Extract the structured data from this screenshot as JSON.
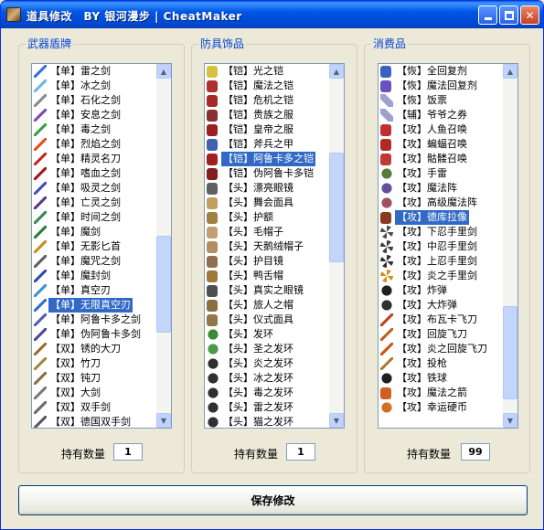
{
  "window": {
    "title": "道具修改　BY 银河漫步 | CheatMaker"
  },
  "groups": [
    {
      "label": "武器盾牌",
      "qty_label": "持有数量",
      "qty_value": "1",
      "scroll_thumb": {
        "start": 0.47,
        "size": 0.29
      },
      "items": [
        {
          "text": "【单】雷之剑",
          "icon": "sword-icon",
          "color": "#3a6fd8"
        },
        {
          "text": "【单】冰之剑",
          "icon": "sword-icon",
          "color": "#6cb8e8"
        },
        {
          "text": "【单】石化之剑",
          "icon": "sword-icon",
          "color": "#8a8a8a"
        },
        {
          "text": "【单】安息之剑",
          "icon": "sword-icon",
          "color": "#7a4ab0"
        },
        {
          "text": "【单】毒之剑",
          "icon": "sword-icon",
          "color": "#3aa040"
        },
        {
          "text": "【单】烈焰之剑",
          "icon": "sword-icon",
          "color": "#e05020"
        },
        {
          "text": "【单】精灵名刀",
          "icon": "sword-icon",
          "color": "#c02828"
        },
        {
          "text": "【单】嗜血之剑",
          "icon": "sword-icon",
          "color": "#a01818"
        },
        {
          "text": "【单】吸灵之剑",
          "icon": "sword-icon",
          "color": "#4050c0"
        },
        {
          "text": "【单】亡灵之剑",
          "icon": "sword-icon",
          "color": "#5a3a8a"
        },
        {
          "text": "【单】时间之剑",
          "icon": "sword-icon",
          "color": "#3a8a50"
        },
        {
          "text": "【单】魔剑",
          "icon": "sword-icon",
          "color": "#2a7a3a"
        },
        {
          "text": "【单】无影匕首",
          "icon": "dagger-icon",
          "color": "#c09020"
        },
        {
          "text": "【单】魔咒之剑",
          "icon": "sword-icon",
          "color": "#606060"
        },
        {
          "text": "【单】魔封剑",
          "icon": "sword-icon",
          "color": "#2a50a0"
        },
        {
          "text": "【单】真空刃",
          "icon": "sword-icon",
          "color": "#4090d0"
        },
        {
          "text": "【单】无限真空刃",
          "icon": "sword-icon",
          "color": "#3070c0",
          "selected": true
        },
        {
          "text": "【单】阿鲁卡多之剑",
          "icon": "sword-icon",
          "color": "#5060b0"
        },
        {
          "text": "【单】伪阿鲁卡多剑",
          "icon": "sword-icon",
          "color": "#4a4a9a"
        },
        {
          "text": "【双】锈的大刀",
          "icon": "blade-icon",
          "color": "#9a6a30"
        },
        {
          "text": "【双】竹刀",
          "icon": "blade-icon",
          "color": "#a08840"
        },
        {
          "text": "【双】钝刀",
          "icon": "blade-icon",
          "color": "#8a7040"
        },
        {
          "text": "【双】大剑",
          "icon": "blade-icon",
          "color": "#7a7a7a"
        },
        {
          "text": "【双】双手剑",
          "icon": "blade-icon",
          "color": "#6a6a6a"
        },
        {
          "text": "【双】德国双手剑",
          "icon": "blade-icon",
          "color": "#5a5a5a"
        }
      ]
    },
    {
      "label": "防具饰品",
      "qty_label": "持有数量",
      "qty_value": "1",
      "scroll_thumb": {
        "start": 0.22,
        "size": 0.33
      },
      "items": [
        {
          "text": "【铠】光之铠",
          "icon": "armor-icon",
          "color": "#d8c040"
        },
        {
          "text": "【铠】魔法之铠",
          "icon": "armor-icon",
          "color": "#b03030"
        },
        {
          "text": "【铠】危机之铠",
          "icon": "armor-icon",
          "color": "#a82828"
        },
        {
          "text": "【铠】贵族之服",
          "icon": "armor-icon",
          "color": "#8a3030"
        },
        {
          "text": "【铠】皇帝之服",
          "icon": "armor-icon",
          "color": "#9a2020"
        },
        {
          "text": "【铠】斧兵之甲",
          "icon": "armor-icon",
          "color": "#4060b0"
        },
        {
          "text": "【铠】阿鲁卡多之铠",
          "icon": "armor-icon",
          "color": "#a02020",
          "selected": true
        },
        {
          "text": "【铠】伪阿鲁卡多铠",
          "icon": "armor-icon",
          "color": "#802020"
        },
        {
          "text": "【头】漂亮眼镜",
          "icon": "glasses-icon",
          "color": "#606060"
        },
        {
          "text": "【头】舞会面具",
          "icon": "mask-icon",
          "color": "#c0a060"
        },
        {
          "text": "【头】护额",
          "icon": "headband-icon",
          "color": "#a08040"
        },
        {
          "text": "【头】毛帽子",
          "icon": "hat-icon",
          "color": "#c0a070"
        },
        {
          "text": "【头】天鹅绒帽子",
          "icon": "hat-icon",
          "color": "#b09060"
        },
        {
          "text": "【头】护目镜",
          "icon": "goggles-icon",
          "color": "#907050"
        },
        {
          "text": "【头】鸭舌帽",
          "icon": "cap-icon",
          "color": "#a07838"
        },
        {
          "text": "【头】真实之眼镜",
          "icon": "glasses-icon",
          "color": "#505050"
        },
        {
          "text": "【头】旅人之帽",
          "icon": "hat-icon",
          "color": "#8a7040"
        },
        {
          "text": "【头】仪式面具",
          "icon": "mask-icon",
          "color": "#907848"
        },
        {
          "text": "【头】发环",
          "icon": "ring-icon",
          "color": "#3a8a3a"
        },
        {
          "text": "【头】圣之发环",
          "icon": "ring-icon",
          "color": "#4a9a4a"
        },
        {
          "text": "【头】炎之发环",
          "icon": "ring-icon",
          "color": "#303030"
        },
        {
          "text": "【头】冰之发环",
          "icon": "ring-icon",
          "color": "#303030"
        },
        {
          "text": "【头】毒之发环",
          "icon": "ring-icon",
          "color": "#303030"
        },
        {
          "text": "【头】雷之发环",
          "icon": "ring-icon",
          "color": "#303030"
        },
        {
          "text": "【头】猫之发环",
          "icon": "ring-icon",
          "color": "#303030"
        }
      ]
    },
    {
      "label": "消费品",
      "qty_label": "持有数量",
      "qty_value": "99",
      "scroll_thumb": {
        "start": 0.68,
        "size": 0.28
      },
      "items": [
        {
          "text": "【恢】全回复剂",
          "icon": "potion-icon",
          "color": "#3a60c0"
        },
        {
          "text": "【恢】魔法回复剂",
          "icon": "potion-icon",
          "color": "#6a50c0"
        },
        {
          "text": "【恢】饭票",
          "icon": "diamond-icon",
          "color": "#a0a0d0"
        },
        {
          "text": "【辅】爷爷之券",
          "icon": "diamond-icon",
          "color": "#a0a0d0"
        },
        {
          "text": "【攻】人鱼召唤",
          "icon": "vial-icon",
          "color": "#c03030"
        },
        {
          "text": "【攻】蝙蝠召唤",
          "icon": "vial-icon",
          "color": "#b02828"
        },
        {
          "text": "【攻】骷髅召唤",
          "icon": "vial-icon",
          "color": "#c03838"
        },
        {
          "text": "【攻】手雷",
          "icon": "grenade-icon",
          "color": "#5a7a3a"
        },
        {
          "text": "【攻】魔法阵",
          "icon": "circle-icon",
          "color": "#6050a0"
        },
        {
          "text": "【攻】高级魔法阵",
          "icon": "circle-icon",
          "color": "#a05060"
        },
        {
          "text": "【攻】德库拉像",
          "icon": "portrait-icon",
          "color": "#8a3a20",
          "selected": true
        },
        {
          "text": "【攻】下忍手里剑",
          "icon": "shuriken-icon",
          "color": "#505050"
        },
        {
          "text": "【攻】中忍手里剑",
          "icon": "shuriken-icon",
          "color": "#404040"
        },
        {
          "text": "【攻】上忍手里剑",
          "icon": "shuriken-icon",
          "color": "#303030"
        },
        {
          "text": "【攻】炎之手里剑",
          "icon": "shuriken-icon",
          "color": "#d09020"
        },
        {
          "text": "【攻】炸弹",
          "icon": "bomb-icon",
          "color": "#202020"
        },
        {
          "text": "【攻】大炸弹",
          "icon": "bomb-icon",
          "color": "#303030"
        },
        {
          "text": "【攻】布瓦卡飞刀",
          "icon": "knife-icon",
          "color": "#c04020"
        },
        {
          "text": "【攻】回旋飞刀",
          "icon": "knife-icon",
          "color": "#c06020"
        },
        {
          "text": "【攻】炎之回旋飞刀",
          "icon": "knife-icon",
          "color": "#d05010"
        },
        {
          "text": "【攻】投枪",
          "icon": "spear-icon",
          "color": "#b07830"
        },
        {
          "text": "【攻】铁球",
          "icon": "ball-icon",
          "color": "#202020"
        },
        {
          "text": "【攻】魔法之箭",
          "icon": "arrow-icon",
          "color": "#d06020"
        },
        {
          "text": "【攻】幸运硬币",
          "icon": "coin-icon",
          "color": "#d07020"
        }
      ]
    }
  ],
  "save_button": {
    "label": "保存修改"
  }
}
